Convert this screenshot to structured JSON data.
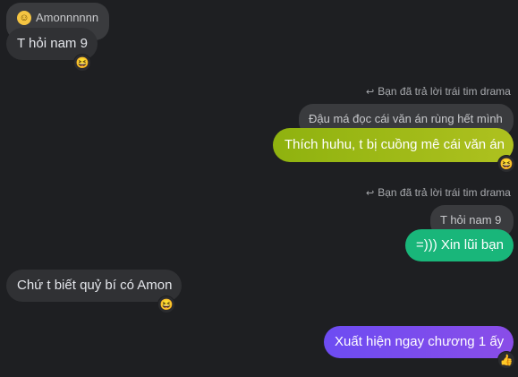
{
  "messages": {
    "m1": {
      "quote_author": "Amonnnnnn",
      "text": "T hỏi nam 9",
      "reaction": "😆"
    },
    "m2": {
      "reply_note": "Bạn đã trả lời trái tim drama",
      "quote": "Đậu má đọc cái văn án rùng hết mình",
      "text": "Thích huhu, t bị cuồng mê cái văn án",
      "reaction": "😆"
    },
    "m3": {
      "reply_note": "Bạn đã trả lời trái tim drama",
      "quote": "T hỏi nam 9",
      "text": "=))) Xin lũi bạn"
    },
    "m4": {
      "text": "Chứ t biết quỷ bí có Amon",
      "reaction": "😆"
    },
    "m5": {
      "text": "Xuất hiện ngay chương 1 ấy",
      "reaction": "👍"
    }
  },
  "colors": {
    "background": "#1e1f22",
    "bubble_dark": "#303134",
    "quote_bg": "#3a3b3e",
    "bubble_lime": "#93b115",
    "bubble_green": "#19b67a",
    "bubble_purple": "#7b4cf0"
  },
  "icons": {
    "reply": "reply-arrow-icon",
    "avatar": "smiley-avatar-icon"
  }
}
